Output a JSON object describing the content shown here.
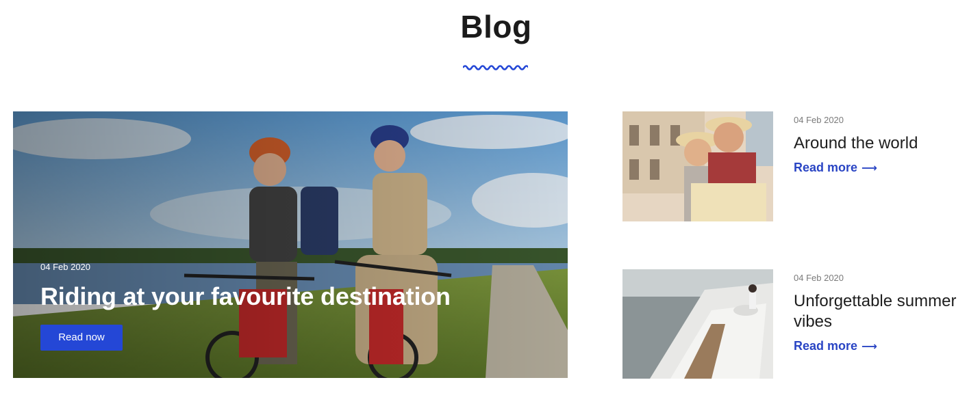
{
  "header": {
    "title": "Blog"
  },
  "featured": {
    "date": "04 Feb 2020",
    "title": "Riding at your favourite destination",
    "button_label": "Read now"
  },
  "posts": [
    {
      "date": "04 Feb 2020",
      "title": "Around the world",
      "link_label": "Read more",
      "link_icon": "arrow-right-icon"
    },
    {
      "date": "04 Feb 2020",
      "title": "Unforgettable summer vibes",
      "link_label": "Read more",
      "link_icon": "arrow-right-icon"
    }
  ],
  "colors": {
    "accent": "#2447d6",
    "link": "#2a45c4",
    "title": "#1b1b1b",
    "date": "#7a7a7a"
  }
}
